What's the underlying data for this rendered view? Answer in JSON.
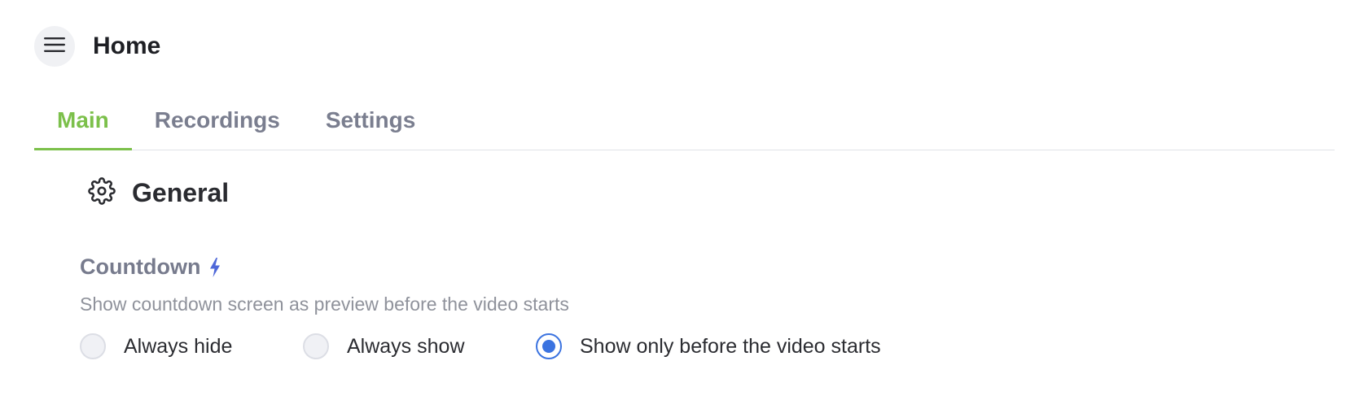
{
  "header": {
    "title": "Home",
    "menu_icon": "menu-icon"
  },
  "tabs": [
    {
      "label": "Main",
      "active": true
    },
    {
      "label": "Recordings",
      "active": false
    },
    {
      "label": "Settings",
      "active": false
    }
  ],
  "section": {
    "title": "General",
    "icon": "gear-icon"
  },
  "setting": {
    "name": "Countdown",
    "badge_icon": "lightning-icon",
    "description": "Show countdown screen as preview before the video starts",
    "options": [
      {
        "label": "Always hide",
        "selected": false
      },
      {
        "label": "Always show",
        "selected": false
      },
      {
        "label": "Show only before the video starts",
        "selected": true
      }
    ]
  },
  "colors": {
    "accent_green": "#7cc04b",
    "radio_blue": "#3b73e0",
    "bolt_blue": "#4f68d8",
    "tab_inactive": "#7a7e8f"
  }
}
